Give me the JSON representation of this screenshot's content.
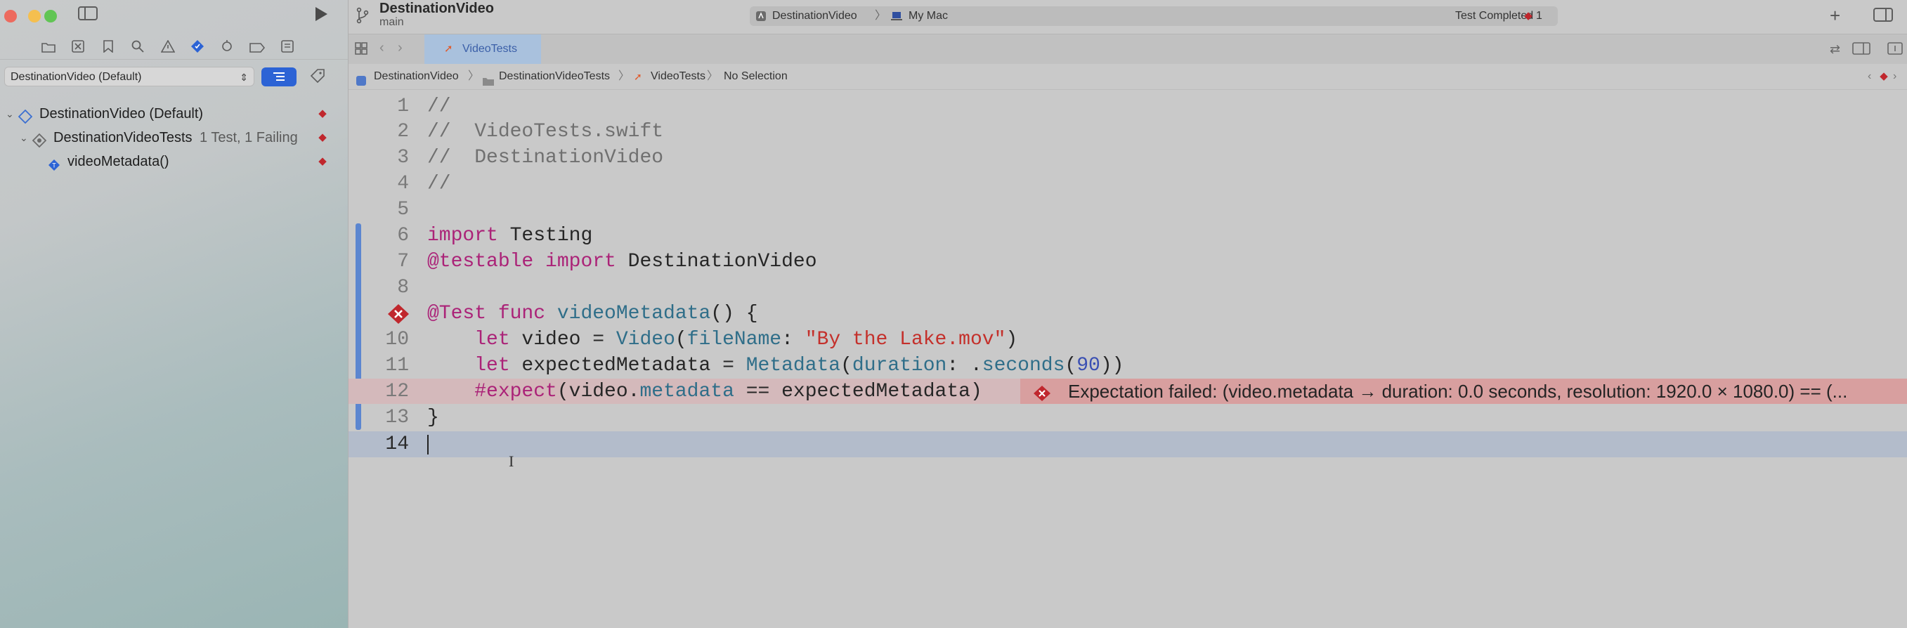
{
  "window": {
    "project_name": "DestinationVideo",
    "branch": "main"
  },
  "activity": {
    "scheme": "DestinationVideo",
    "destination": "My Mac",
    "status": "Test Completed",
    "error_count": "1"
  },
  "sidebar": {
    "scheme_selector": "DestinationVideo (Default)",
    "tree": [
      {
        "label": "DestinationVideo (Default)",
        "detail": ""
      },
      {
        "label": "DestinationVideoTests",
        "detail": "1 Test, 1 Failing"
      },
      {
        "label": "videoMetadata()",
        "detail": ""
      }
    ]
  },
  "editor": {
    "tab_label": "VideoTests",
    "jumpbar": [
      "DestinationVideo",
      "DestinationVideoTests",
      "VideoTests",
      "No Selection"
    ],
    "line_numbers": [
      "1",
      "2",
      "3",
      "4",
      "5",
      "6",
      "7",
      "8",
      "9",
      "10",
      "11",
      "12",
      "13",
      "14"
    ],
    "error_message": "Expectation failed: (video.metadata → duration: 0.0 seconds, resolution: 1920.0 × 1080.0) == (...",
    "code": {
      "l1": "//",
      "l2": "//  VideoTests.swift",
      "l3": "//  DestinationVideo",
      "l4": "//",
      "l6_kw": "import",
      "l6_mod": " Testing",
      "l7_attr": "@testable",
      "l7_kw": " import",
      "l7_mod": " DestinationVideo",
      "l9_attr": "@Test",
      "l9_kw": " func",
      "l9_fn": " videoMetadata",
      "l9_rest": "() {",
      "l10_kw": "    let",
      "l10_a": " video = ",
      "l10_ty": "Video",
      "l10_b": "(",
      "l10_lbl": "fileName",
      "l10_c": ": ",
      "l10_str": "\"By the Lake.mov\"",
      "l10_d": ")",
      "l11_kw": "    let",
      "l11_a": " expectedMetadata = ",
      "l11_ty": "Metadata",
      "l11_b": "(",
      "l11_lbl": "duration",
      "l11_c": ": .",
      "l11_fn": "seconds",
      "l11_d": "(",
      "l11_num": "90",
      "l11_e": "))",
      "l12_macro": "    #expect",
      "l12_a": "(video.",
      "l12_prop": "metadata",
      "l12_b": " == expectedMetadata)",
      "l13": "}"
    }
  },
  "colors": {
    "accent": "#2c63d5",
    "error": "#c0272d",
    "error_banner": "#d89f9f",
    "current_line": "#b3bccb"
  }
}
